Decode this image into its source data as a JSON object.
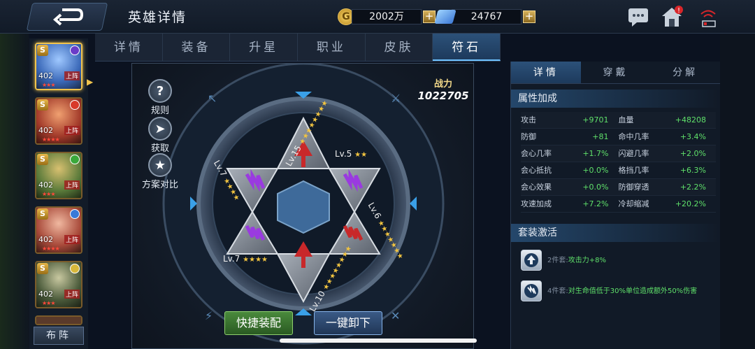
{
  "header": {
    "title": "英雄详情",
    "gold": {
      "value": "2002万",
      "plus": "+"
    },
    "gems": {
      "value": "24767",
      "plus": "+"
    }
  },
  "tabs": [
    {
      "label": "详情"
    },
    {
      "label": "装备"
    },
    {
      "label": "升星"
    },
    {
      "label": "职业"
    },
    {
      "label": "皮肤"
    },
    {
      "label": "符石",
      "active": true
    }
  ],
  "heroes": [
    {
      "grade": "S",
      "level": "402",
      "status": "上阵",
      "stars": "★★★",
      "portrait": "#3a68b8",
      "badge": "#6a3cc8",
      "selected": true
    },
    {
      "grade": "S",
      "level": "402",
      "status": "上阵",
      "stars": "★★★★",
      "portrait": "#a23a2a",
      "badge": "#d83a2a"
    },
    {
      "grade": "S",
      "level": "402",
      "status": "上阵",
      "stars": "★★★",
      "portrait": "#5a7a3a",
      "badge": "#3aa83a"
    },
    {
      "grade": "S",
      "level": "402",
      "status": "上阵",
      "stars": "★★★★",
      "portrait": "#a84a3a",
      "badge": "#3a7ad8"
    },
    {
      "grade": "S",
      "level": "402",
      "status": "上阵",
      "stars": "★★★",
      "portrait": "#4a5a3a",
      "badge": "#d8b83a"
    }
  ],
  "arrange_label": "布阵",
  "stage": {
    "rules_label": "规则",
    "obtain_label": "获取",
    "compare_label": "方案对比",
    "power_label": "战力",
    "power_value": "1022705",
    "runes": [
      {
        "level": "Lv.15",
        "stars": "★★★★★★★★"
      },
      {
        "level": "Lv.5",
        "stars": "★★"
      },
      {
        "level": "Lv.6",
        "stars": "★★★★★★★"
      },
      {
        "level": "Lv.10",
        "stars": "★★★★★★★★"
      },
      {
        "level": "Lv.7",
        "stars": "★★★★"
      },
      {
        "level": "Lv.7",
        "stars": "★★★★"
      }
    ],
    "quick_equip": "快捷装配",
    "unequip_all": "一键卸下"
  },
  "right_panel": {
    "tabs": [
      {
        "label": "详情",
        "active": true
      },
      {
        "label": "穿戴"
      },
      {
        "label": "分解"
      }
    ],
    "attr_title": "属性加成",
    "attributes": [
      [
        "攻击",
        "+9701",
        "血量",
        "+48208"
      ],
      [
        "防御",
        "+81",
        "命中几率",
        "+3.4%"
      ],
      [
        "会心几率",
        "+1.7%",
        "闪避几率",
        "+2.0%"
      ],
      [
        "会心抵抗",
        "+0.0%",
        "格挡几率",
        "+6.3%"
      ],
      [
        "会心效果",
        "+0.0%",
        "防御穿透",
        "+2.2%"
      ],
      [
        "攻速加成",
        "+7.2%",
        "冷却缩减",
        "+20.2%"
      ]
    ],
    "set_title": "套装激活",
    "sets": [
      {
        "count": "2件套:",
        "effect": "攻击力+8%"
      },
      {
        "count": "4件套:",
        "effect": "对生命值低于30%单位造成额外50%伤害"
      }
    ]
  },
  "colors": {
    "accent": "#6fc3ff",
    "positive": "#5fe06a",
    "gold": "#f0c34d",
    "rune_red": "#c8282a",
    "rune_purple": "#9a3ae0"
  }
}
